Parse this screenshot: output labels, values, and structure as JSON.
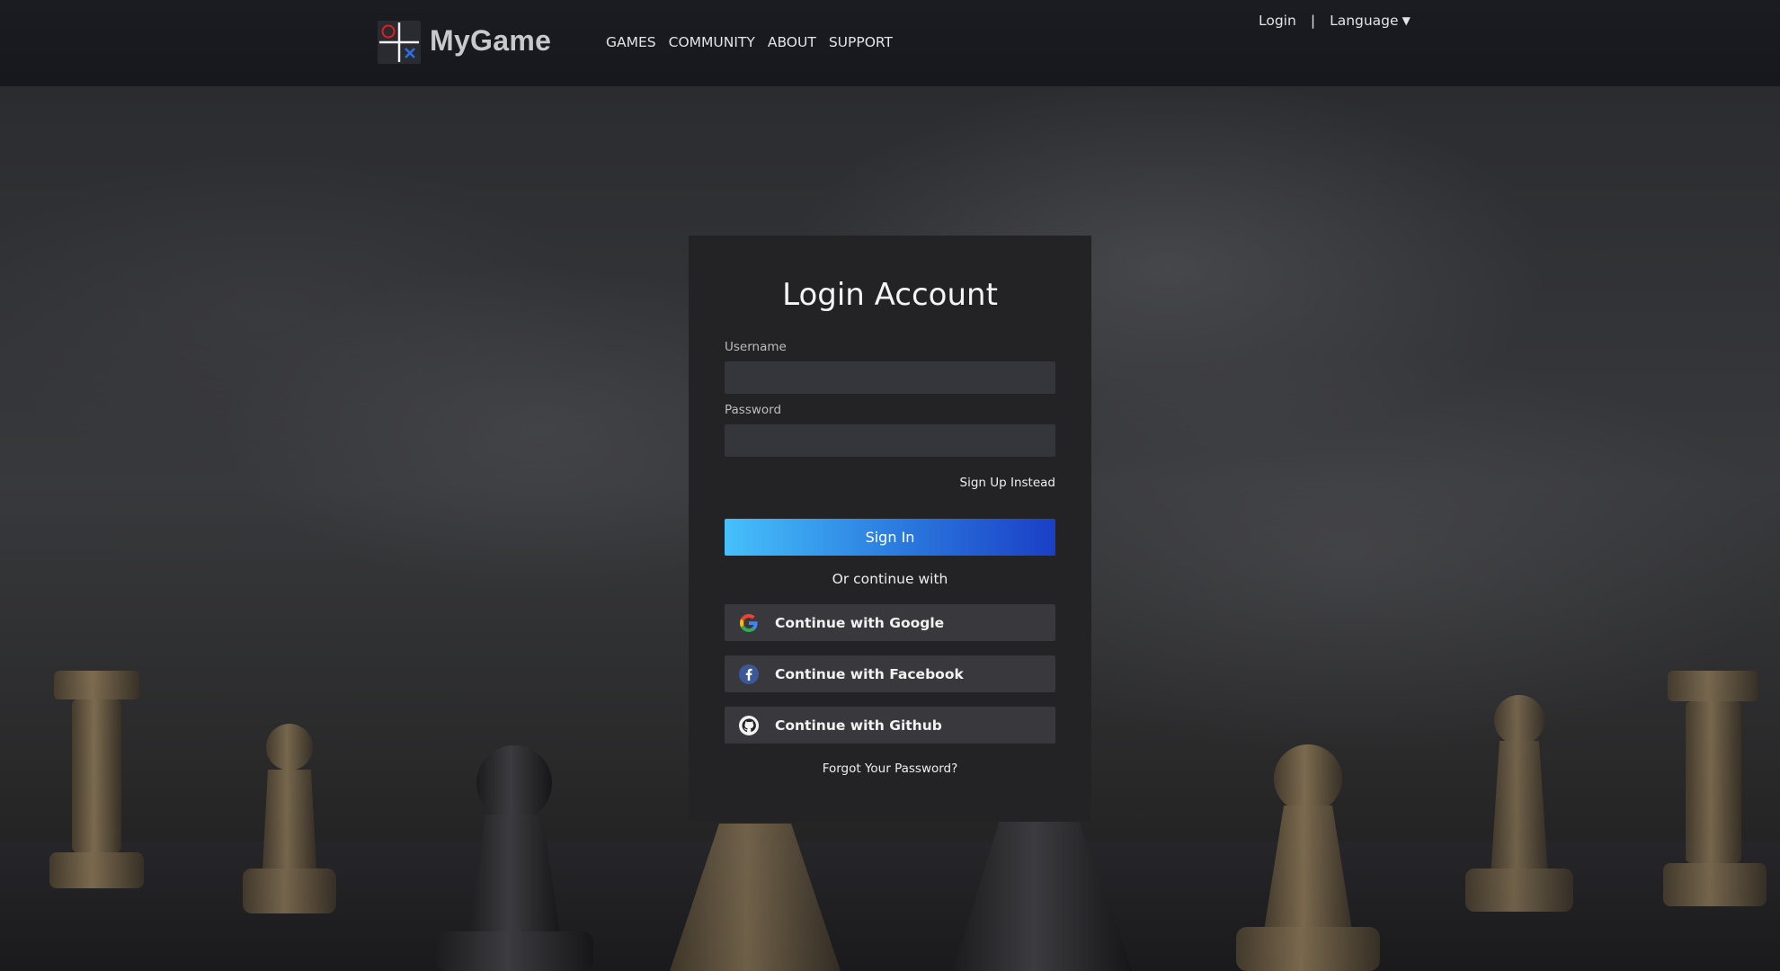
{
  "header": {
    "brand": "MyGame",
    "nav": [
      "GAMES",
      "COMMUNITY",
      "ABOUT",
      "SUPPORT"
    ],
    "login_link": "Login",
    "separator": "|",
    "language_label": "Language",
    "language_caret": "▼"
  },
  "login": {
    "title": "Login Account",
    "username_label": "Username",
    "username_value": "",
    "password_label": "Password",
    "password_value": "",
    "signup_link": "Sign Up Instead",
    "signin_button": "Sign In",
    "or_continue": "Or continue with",
    "google_button": "Continue with Google",
    "facebook_button": "Continue with Facebook",
    "github_button": "Continue with Github",
    "forgot_link": "Forgot Your Password?"
  },
  "colors": {
    "header_bg": "#16181d",
    "card_bg": "#232325",
    "field_bg": "#35363b",
    "signin_gradient_start": "#46c0fb",
    "signin_gradient_end": "#1a3fc6",
    "social_bg": "#39393d",
    "facebook_blue": "#3b5998",
    "logo_red": "#e02020",
    "logo_blue": "#2f6fe6"
  },
  "icons": {
    "logo": "tic-tac-toe-logo",
    "google": "google-icon",
    "facebook": "facebook-icon",
    "github": "github-icon",
    "caret": "chevron-down-icon"
  }
}
